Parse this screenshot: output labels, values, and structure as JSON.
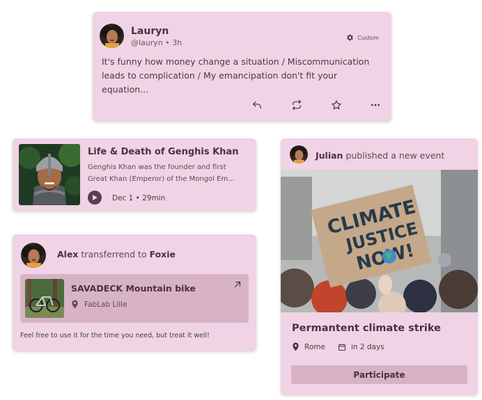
{
  "post": {
    "author": "Lauryn",
    "handle": "@lauryn • 3h",
    "custom_label": "Custom",
    "body": "It's funny how money change a situation / Miscommunication leads to complication / My emancipation don't fit your equation...",
    "icons": [
      "reply-icon",
      "repost-icon",
      "star-icon",
      "more-icon"
    ]
  },
  "podcast": {
    "title": "Life & Death of Genghis Khan",
    "desc_line1": "Genghis Khan was the founder and first",
    "desc_line2": "Great Khan (Emperor) of the Mongol Em...",
    "meta": "Dec 1 • 29min"
  },
  "transfer": {
    "from": "Alex",
    "verb": "transferrend to",
    "to": "Foxie",
    "item_name": "SAVADECK Mountain bike",
    "item_location": "FabLab Lille",
    "note": "Feel free to use it for the time you need, but treat it well!"
  },
  "event": {
    "publisher": "Julian",
    "action": "published a new event",
    "sign_line1": "CLIMATE",
    "sign_line2": "JUSTICE",
    "sign_line3": "NOW!",
    "title": "Permantent climate strike",
    "location": "Rome",
    "when": "in 2 days",
    "button": "Participate"
  },
  "colors": {
    "card_bg": "#f0d3e4",
    "inner_bg": "#d8b3c6",
    "text_dark": "#4b3141"
  }
}
